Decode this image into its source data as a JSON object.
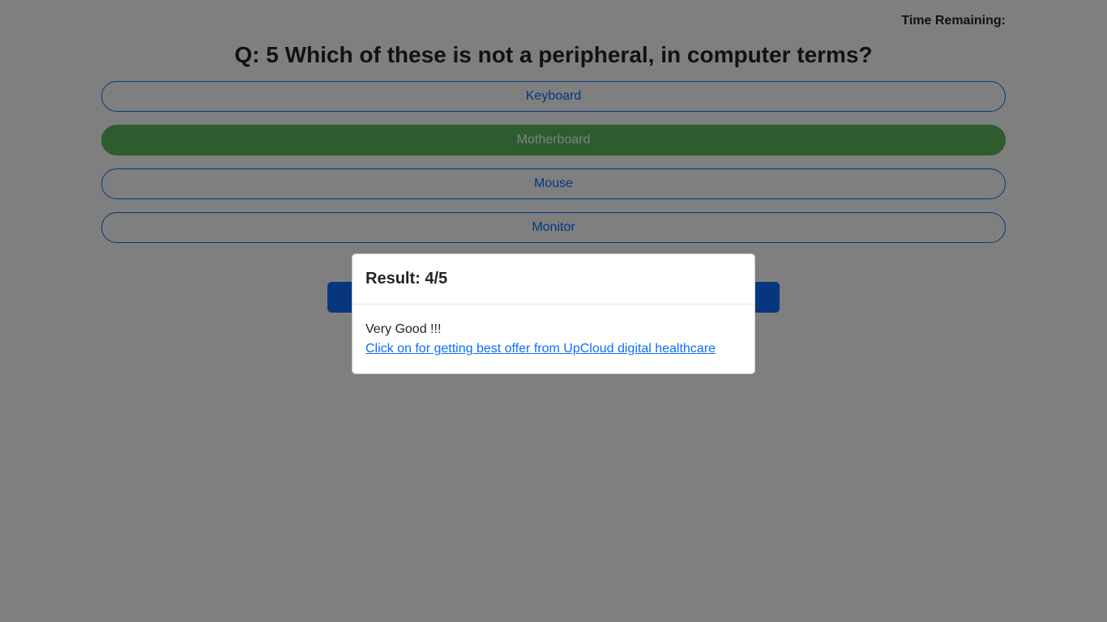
{
  "timer": {
    "label": "Time Remaining:"
  },
  "question": {
    "text": "Q: 5 Which of these is not a peripheral, in computer terms?"
  },
  "options": [
    {
      "label": "Keyboard",
      "selected": false
    },
    {
      "label": "Motherboard",
      "selected": true
    },
    {
      "label": "Mouse",
      "selected": false
    },
    {
      "label": "Monitor",
      "selected": false
    }
  ],
  "modal": {
    "title": "Result: 4/5",
    "message": "Very Good !!!",
    "link_text": "Click on for getting best offer from UpCloud digital healthcare"
  },
  "colors": {
    "primary": "#0d6efd",
    "selected": "#5cb85c",
    "overlay": "rgba(0,0,0,0.5)"
  }
}
